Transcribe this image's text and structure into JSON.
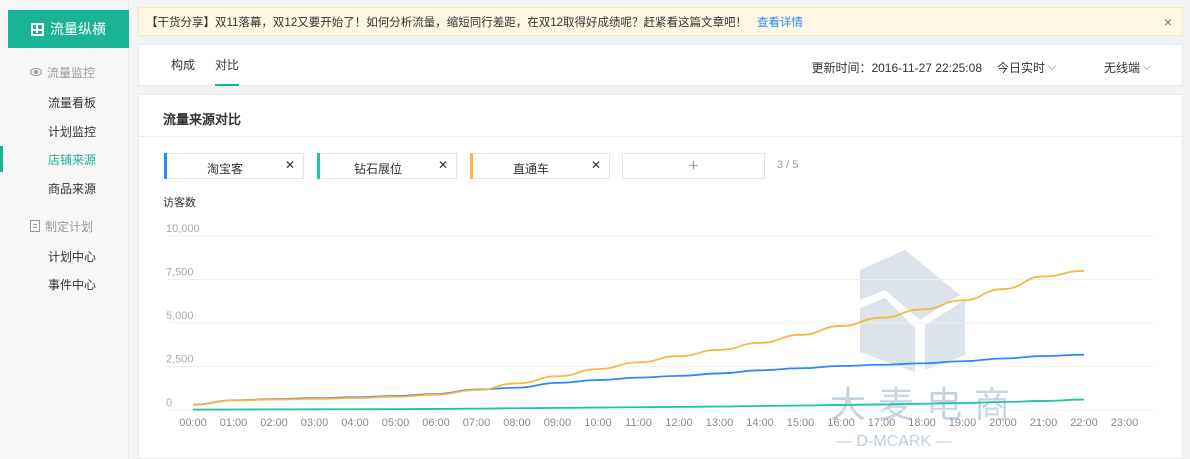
{
  "sidebar": {
    "brand": "流量纵横",
    "groups": [
      {
        "label": "流量监控",
        "icon": "eye-icon"
      },
      {
        "label": "制定计划",
        "icon": "document-icon"
      }
    ],
    "items": [
      {
        "label": "流量看板",
        "active": false
      },
      {
        "label": "计划监控",
        "active": false
      },
      {
        "label": "店铺来源",
        "active": true
      },
      {
        "label": "商品来源",
        "active": false
      },
      {
        "label": "计划中心",
        "active": false
      },
      {
        "label": "事件中心",
        "active": false
      }
    ]
  },
  "notice": {
    "text": "【干货分享】双11落幕，双12又要开始了！如何分析流量，缩短同行差距，在双12取得好成绩呢？赶紧看这篇文章吧！",
    "link": "查看详情",
    "close": "×"
  },
  "tabs": [
    {
      "label": "构成",
      "active": false
    },
    {
      "label": "对比",
      "active": true
    }
  ],
  "header": {
    "update_time": "更新时间：2016-11-27 22:25:08",
    "period": "今日实时",
    "device": "无线端"
  },
  "card": {
    "title": "流量来源对比",
    "chips": [
      {
        "label": "淘宝客",
        "color": "#2d8cf0"
      },
      {
        "label": "钻石展位",
        "color": "#1fc4a4"
      },
      {
        "label": "直通车",
        "color": "#f5b941"
      }
    ],
    "add": "+",
    "count": "3 / 5",
    "close_glyph": "✕"
  },
  "watermark": {
    "text": "大麦电商",
    "subtext": "— D-MCARK —"
  },
  "chart_data": {
    "type": "line",
    "ylabel": "访客数",
    "ylim": [
      0,
      10000
    ],
    "yticks": [
      "0",
      "2,500",
      "5,000",
      "7,500",
      "10,000"
    ],
    "x": [
      "00:00",
      "01:00",
      "02:00",
      "03:00",
      "04:00",
      "05:00",
      "06:00",
      "07:00",
      "08:00",
      "09:00",
      "10:00",
      "11:00",
      "12:00",
      "13:00",
      "14:00",
      "15:00",
      "16:00",
      "17:00",
      "18:00",
      "19:00",
      "20:00",
      "21:00",
      "22:00",
      "23:00"
    ],
    "series": [
      {
        "name": "淘宝客",
        "color": "#2d8cf0",
        "values": [
          300,
          560,
          620,
          680,
          730,
          800,
          920,
          1180,
          1280,
          1560,
          1720,
          1860,
          1960,
          2100,
          2280,
          2400,
          2530,
          2600,
          2680,
          2800,
          2960,
          3100,
          3180
        ]
      },
      {
        "name": "钻石展位",
        "color": "#1fc4a4",
        "values": [
          20,
          30,
          35,
          40,
          45,
          50,
          60,
          80,
          100,
          120,
          140,
          160,
          180,
          200,
          230,
          260,
          290,
          320,
          360,
          400,
          460,
          520,
          600
        ]
      },
      {
        "name": "直通车",
        "color": "#f5b941",
        "values": [
          300,
          550,
          600,
          640,
          690,
          760,
          880,
          1150,
          1530,
          1940,
          2350,
          2740,
          3100,
          3460,
          3860,
          4320,
          4830,
          5300,
          5780,
          6300,
          6950,
          7680,
          8000
        ]
      }
    ],
    "grid": true,
    "legend": "top-left"
  }
}
